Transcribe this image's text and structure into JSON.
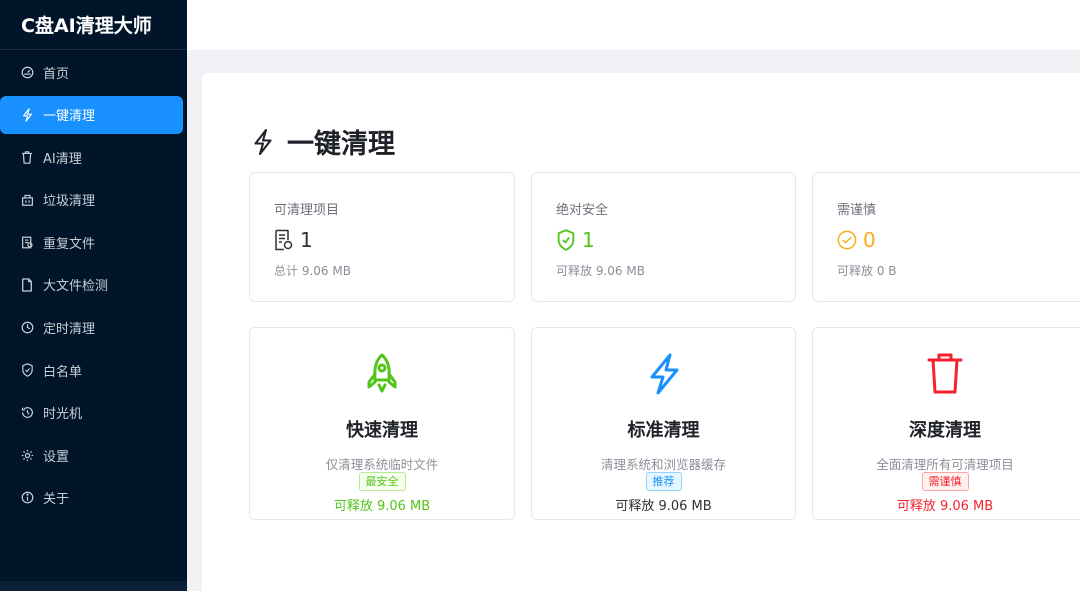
{
  "app": {
    "title": "C盘AI清理大师"
  },
  "sidebar": {
    "items": [
      {
        "label": "首页",
        "icon": "dashboard-icon"
      },
      {
        "label": "一键清理",
        "icon": "lightning-icon",
        "active": true
      },
      {
        "label": "AI清理",
        "icon": "trash-icon"
      },
      {
        "label": "垃圾清理",
        "icon": "bin-icon"
      },
      {
        "label": "重复文件",
        "icon": "duplicate-icon"
      },
      {
        "label": "大文件检测",
        "icon": "file-icon"
      },
      {
        "label": "定时清理",
        "icon": "clock-icon"
      },
      {
        "label": "白名单",
        "icon": "shield-check-icon"
      },
      {
        "label": "时光机",
        "icon": "history-icon"
      },
      {
        "label": "设置",
        "icon": "gear-icon"
      },
      {
        "label": "关于",
        "icon": "info-icon"
      }
    ]
  },
  "page": {
    "title": "一键清理"
  },
  "stats": [
    {
      "title": "可清理项目",
      "value": "1",
      "sub": "总计 9.06 MB",
      "icon": "document-icon",
      "color": "#303133"
    },
    {
      "title": "绝对安全",
      "value": "1",
      "sub": "可释放 9.06 MB",
      "icon": "shield-check-icon",
      "color": "#52c41a"
    },
    {
      "title": "需谨慎",
      "value": "0",
      "sub": "可释放 0 B",
      "icon": "check-circle-icon",
      "color": "#faad14"
    }
  ],
  "modes": [
    {
      "title": "快速清理",
      "desc": "仅清理系统临时文件",
      "tag": "最安全",
      "release": "可释放 9.06 MB",
      "icon": "rocket-icon",
      "color": "#52c41a"
    },
    {
      "title": "标准清理",
      "desc": "清理系统和浏览器缓存",
      "tag": "推荐",
      "release": "可释放 9.06 MB",
      "icon": "lightning-icon",
      "color": "#1890ff"
    },
    {
      "title": "深度清理",
      "desc": "全面清理所有可清理项目",
      "tag": "需谨慎",
      "release": "可释放 9.06 MB",
      "icon": "trash-icon",
      "color": "#f5222d"
    }
  ]
}
